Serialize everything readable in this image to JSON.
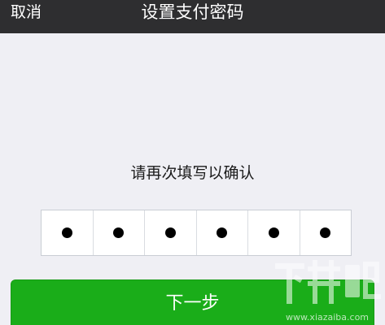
{
  "nav": {
    "cancel_label": "取消",
    "title": "设置支付密码"
  },
  "main": {
    "prompt": "请再次填写以确认",
    "pin": {
      "length": 6,
      "filled": 6
    },
    "next_label": "下一步"
  },
  "watermark": {
    "brand": "下载吧",
    "url": "www.xiazaiba.com"
  },
  "colors": {
    "nav_bg": "#2e2e30",
    "page_bg": "#efeff4",
    "accent_green": "#1aad19"
  }
}
